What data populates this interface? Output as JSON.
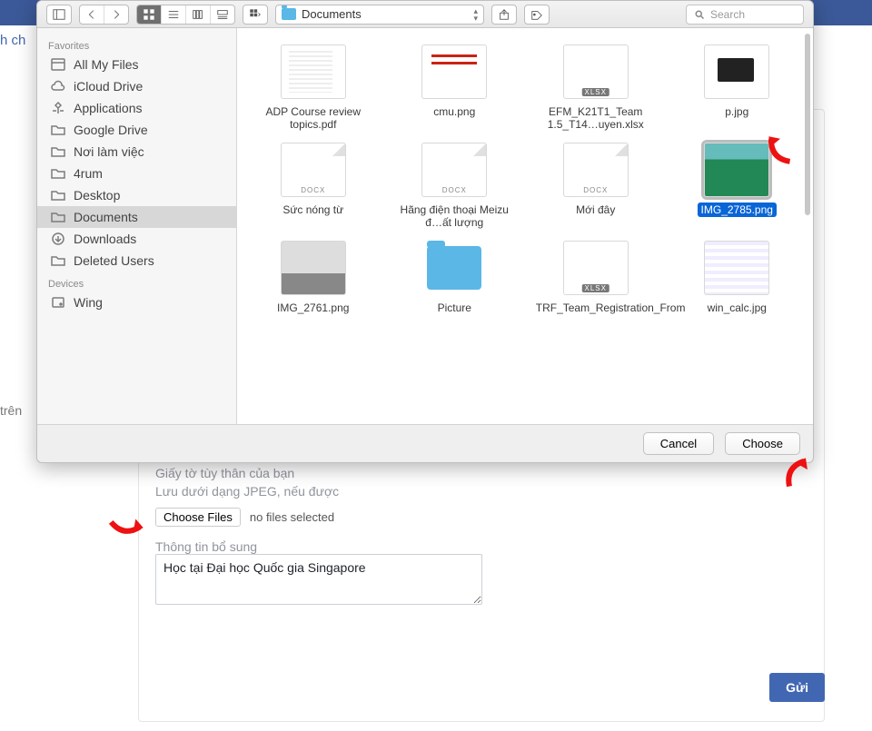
{
  "header_link_text": "h ch",
  "left_text": "trên",
  "toolbar": {
    "location": "Documents",
    "search_placeholder": "Search"
  },
  "sidebar": {
    "favorites_header": "Favorites",
    "devices_header": "Devices",
    "favorites": [
      {
        "label": "All My Files",
        "icon": "all-files"
      },
      {
        "label": "iCloud Drive",
        "icon": "cloud"
      },
      {
        "label": "Applications",
        "icon": "apps"
      },
      {
        "label": "Google Drive",
        "icon": "folder"
      },
      {
        "label": "Nơi làm việc",
        "icon": "folder"
      },
      {
        "label": "4rum",
        "icon": "folder"
      },
      {
        "label": "Desktop",
        "icon": "folder"
      },
      {
        "label": "Documents",
        "icon": "folder",
        "selected": true
      },
      {
        "label": "Downloads",
        "icon": "download"
      },
      {
        "label": "Deleted Users",
        "icon": "folder"
      }
    ],
    "devices": [
      {
        "label": "Wing",
        "icon": "disk"
      }
    ]
  },
  "files": [
    {
      "name": "ADP Course review topics.pdf",
      "kind": "pdf"
    },
    {
      "name": "cmu.png",
      "kind": "png-redbar"
    },
    {
      "name": "EFM_K21T1_Team 1.5_T14…uyen.xlsx",
      "kind": "xlsx"
    },
    {
      "name": "p.jpg",
      "kind": "laptop"
    },
    {
      "name": "Sức nóng từ",
      "kind": "docx"
    },
    {
      "name": "Hãng điện thoại Meizu đ…ất lượng",
      "kind": "docx"
    },
    {
      "name": "Mới đây",
      "kind": "docx"
    },
    {
      "name": "IMG_2785.png",
      "kind": "man",
      "selected": true
    },
    {
      "name": "IMG_2761.png",
      "kind": "people"
    },
    {
      "name": "Picture",
      "kind": "folder"
    },
    {
      "name": "TRF_Team_Registration_From",
      "kind": "xlsx"
    },
    {
      "name": "win_calc.jpg",
      "kind": "sheet"
    }
  ],
  "dialog": {
    "cancel": "Cancel",
    "choose": "Choose"
  },
  "form": {
    "id_label": "Giấy tờ tùy thân của bạn",
    "id_hint": "Lưu dưới dạng JPEG, nếu được",
    "choose_files": "Choose Files",
    "no_files": "no files selected",
    "extra_label": "Thông tin bổ sung",
    "extra_value": "Học tại Đại học Quốc gia Singapore",
    "submit": "Gửi"
  }
}
